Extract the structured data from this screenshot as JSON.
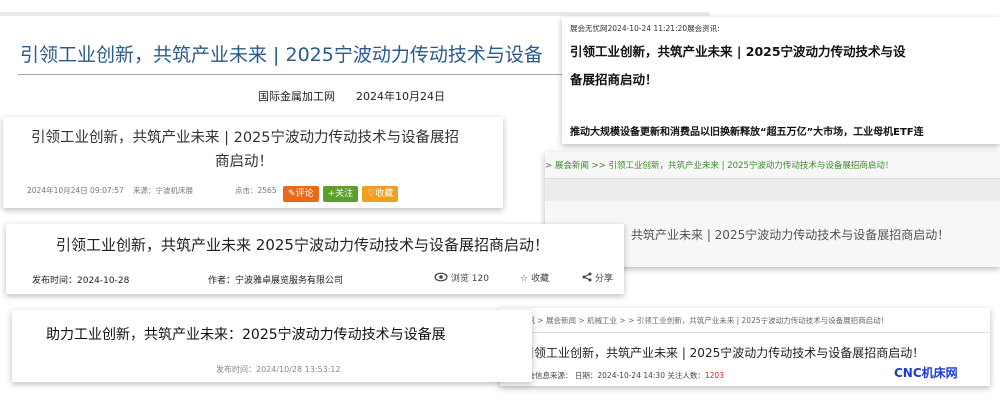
{
  "card1": {
    "title": "引领工业创新，共筑产业未来 | 2025宁波动力传动技术与设备",
    "source": "国际金属加工网",
    "date": "2024年10月24日"
  },
  "card2": {
    "header": "展会无忧网2024-10-24 11:21:20展会资讯:",
    "title_line1": "引领工业创新，共筑产业未来 | 2025宁波动力传动技术与设",
    "title_line2": "备展招商启动！",
    "related": "推动大规模设备更新和消费品以旧换新释放“超五万亿”大市场，工业母机ETF连"
  },
  "card3": {
    "title_line1": "引领工业创新，共筑产业未来 | 2025宁波动力传动技术与设备展招",
    "title_line2": "商启动！",
    "date": "2024年10月24日 09:07:57",
    "source": "来源：宁波机床展",
    "clicks": "点击：2565",
    "comment_label": "评论",
    "follow_label": "关注",
    "favorite_label": "收藏"
  },
  "card4": {
    "breadcrumb": "> 展会新闻   >>  引领工业创新，共筑产业未来 | 2025宁波动力传动技术与设备展招商启动！",
    "title": "动！，共筑产业未来 | 2025宁波动力传动技术与设备展招商启动！"
  },
  "card5": {
    "title": "引领工业创新，共筑产业未来 2025宁波动力传动技术与设备展招商启动！",
    "publish": "发布时间：2024-10-28",
    "author": "作者：宁波雅卓展览服务有限公司",
    "views": "浏览 120",
    "favorite": "收藏",
    "share": "分享"
  },
  "card6": {
    "title": "助力工业创新，共筑产业未来：2025宁波动力传动技术与设备展",
    "publish": "发布时间：2024/10/28 13:53:12"
  },
  "card7": {
    "breadcrumb": "| 展会快讯 > 展会新闻 > 机械工业 > > 引领工业创新，共筑产业未来 | 2025宁波动力传动技术与设备展招商启动！",
    "title": "引领工业创新，共筑产业未来 | 2025宁波动力传动技术与设备展招商启动！",
    "meta": "展会信息来源：            日期：2024-10-24 14:30 关注人数：",
    "count": "1203",
    "watermark": "CNC机床网"
  },
  "colors": {
    "blue_title": "#2a5a8c",
    "green_breadcrumb": "#3a8a2a",
    "orange_btn": "#e86a1a",
    "green_btn": "#5aa02a",
    "yellow_btn": "#f0a020",
    "red_count": "#e02020",
    "watermark_blue": "#1a3ad8"
  }
}
